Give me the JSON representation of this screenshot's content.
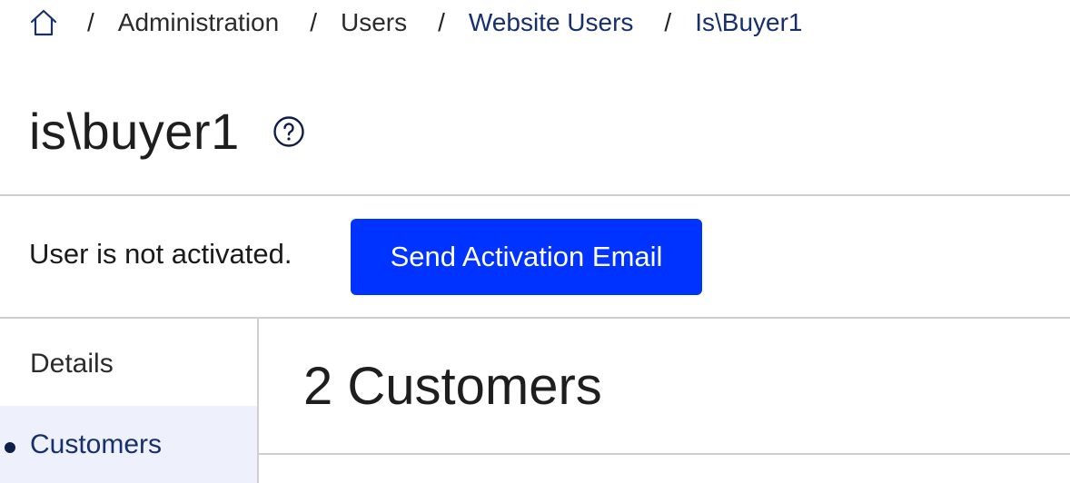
{
  "breadcrumb": {
    "home_icon": "home-icon",
    "separator": "/",
    "items": [
      {
        "label": "Administration"
      },
      {
        "label": "Users"
      },
      {
        "label": "Website Users"
      },
      {
        "label": "Is\\Buyer1"
      }
    ]
  },
  "page": {
    "title": "is\\buyer1",
    "help_icon": "help-icon"
  },
  "activation": {
    "status_text": "User is not activated.",
    "button_label": "Send Activation Email"
  },
  "sidebar": {
    "items": [
      {
        "label": "Details",
        "active": false
      },
      {
        "label": "Customers",
        "active": true
      }
    ]
  },
  "main": {
    "section_title": "2 Customers"
  },
  "colors": {
    "primary_button": "#0033ff",
    "link": "#16306e",
    "active_nav_bg": "#eef0fb"
  }
}
